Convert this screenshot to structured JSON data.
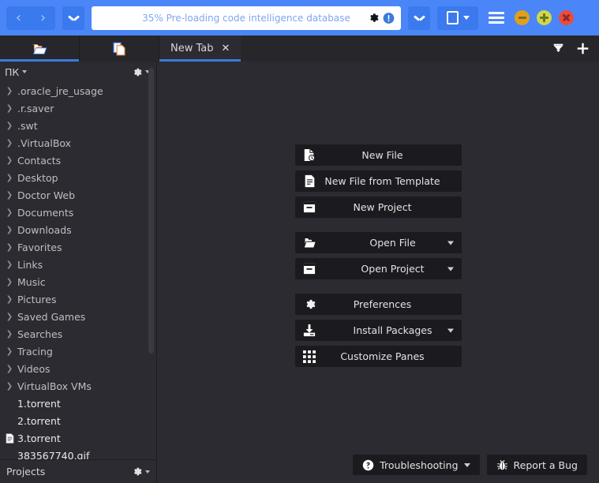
{
  "toolbar": {
    "back_label": "‹",
    "forward_label": "›",
    "progress_text": "35% Pre-loading code intelligence database",
    "progress_percent": 35,
    "settings_icon": "gear-icon",
    "notification_icon": "info-icon",
    "minimize_label": "minimize",
    "maximize_label": "maximize",
    "close_label": "close",
    "accent_color": "#4a86f7",
    "minimize_color": "#dfa01b",
    "maximize_color": "#cfd84a",
    "close_color": "#ed4a3f"
  },
  "tabbar": {
    "tool_tabs": [
      {
        "name": "files-tab",
        "icon": "folder-open-icon",
        "selected": true
      },
      {
        "name": "documents-tab",
        "icon": "copy-files-icon",
        "selected": false
      }
    ],
    "doc_tabs": [
      {
        "label": "New Tab",
        "close_label": "✕",
        "selected": true
      }
    ],
    "restore_icon": "restore-window-icon",
    "add_icon": "plus-icon"
  },
  "sidebar": {
    "header_title": "ПК",
    "header_caret": "▾",
    "header_gear_icon": "gear-icon",
    "footer_title": "Projects",
    "footer_gear_icon": "gear-icon",
    "items": [
      {
        "name": ".oracle_jre_usage",
        "type": "folder"
      },
      {
        "name": ".r.saver",
        "type": "folder"
      },
      {
        "name": ".swt",
        "type": "folder"
      },
      {
        "name": ".VirtualBox",
        "type": "folder"
      },
      {
        "name": "Contacts",
        "type": "folder"
      },
      {
        "name": "Desktop",
        "type": "folder"
      },
      {
        "name": "Doctor Web",
        "type": "folder"
      },
      {
        "name": "Documents",
        "type": "folder"
      },
      {
        "name": "Downloads",
        "type": "folder"
      },
      {
        "name": "Favorites",
        "type": "folder"
      },
      {
        "name": "Links",
        "type": "folder"
      },
      {
        "name": "Music",
        "type": "folder"
      },
      {
        "name": "Pictures",
        "type": "folder"
      },
      {
        "name": "Saved Games",
        "type": "folder"
      },
      {
        "name": "Searches",
        "type": "folder"
      },
      {
        "name": "Tracing",
        "type": "folder"
      },
      {
        "name": "Videos",
        "type": "folder"
      },
      {
        "name": "VirtualBox VMs",
        "type": "folder"
      },
      {
        "name": "1.torrent",
        "type": "file"
      },
      {
        "name": "2.torrent",
        "type": "file"
      },
      {
        "name": "3.torrent",
        "type": "file",
        "has_icon": true
      },
      {
        "name": "383567740.gif",
        "type": "file"
      }
    ]
  },
  "welcome": {
    "buttons": [
      {
        "label": "New File",
        "icon": "new-file-icon",
        "dropdown": false
      },
      {
        "label": "New File from Template",
        "icon": "template-file-icon",
        "dropdown": false
      },
      {
        "label": "New Project",
        "icon": "project-icon",
        "dropdown": false
      },
      {
        "label": "Open File",
        "icon": "folder-open-icon",
        "dropdown": true
      },
      {
        "label": "Open Project",
        "icon": "project-icon",
        "dropdown": true
      },
      {
        "label": "Preferences",
        "icon": "gear-icon",
        "dropdown": false
      },
      {
        "label": "Install Packages",
        "icon": "download-icon",
        "dropdown": true
      },
      {
        "label": "Customize Panes",
        "icon": "grid-icon",
        "dropdown": false
      }
    ],
    "footer_buttons": [
      {
        "label": "Troubleshooting",
        "icon": "help-circle-icon",
        "dropdown": true
      },
      {
        "label": "Report a Bug",
        "icon": "bug-icon",
        "dropdown": false
      }
    ]
  }
}
